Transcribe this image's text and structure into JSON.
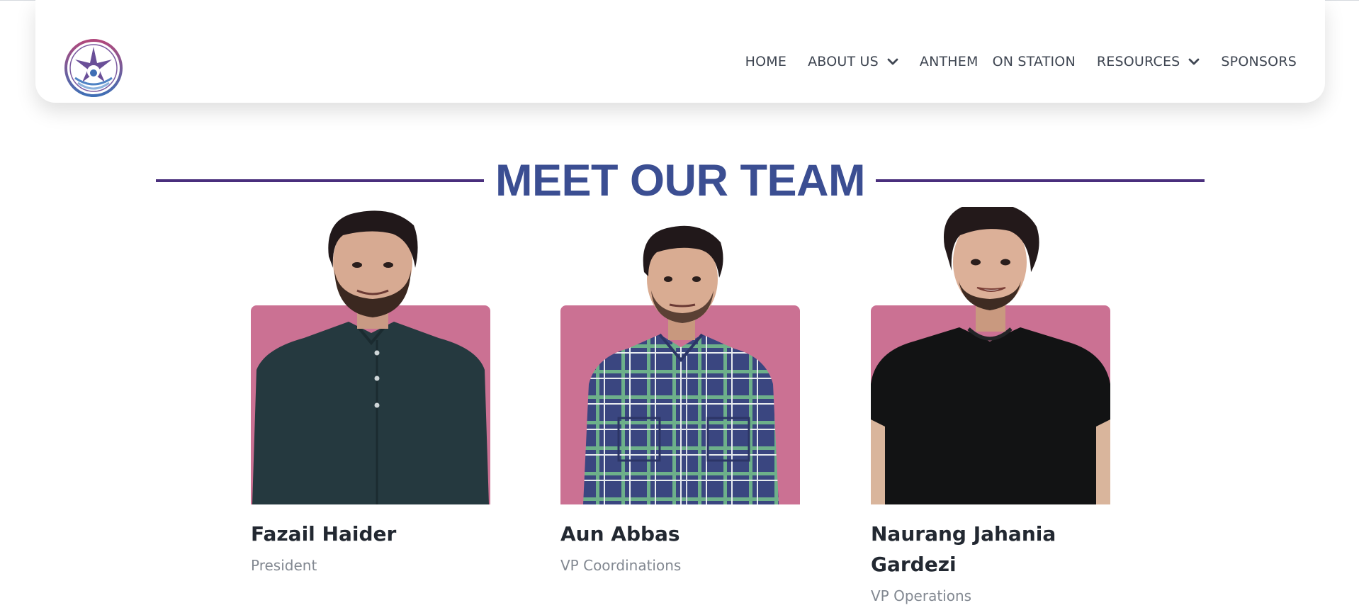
{
  "nav": {
    "items": [
      {
        "label": "HOME"
      },
      {
        "label": "ABOUT US",
        "has_dropdown": true
      },
      {
        "label": "ANTHEM"
      },
      {
        "label": "ON STATION"
      },
      {
        "label": "RESOURCES",
        "has_dropdown": true
      },
      {
        "label": "SPONSORS"
      }
    ],
    "logo_icon": "compass-emblem-icon"
  },
  "section": {
    "title": "MEET OUR TEAM"
  },
  "team": [
    {
      "name": "Fazail Haider",
      "role": "President",
      "shirt": "dark-teal-kurta"
    },
    {
      "name": "Aun Abbas",
      "role": "VP Coordinations",
      "shirt": "navy-green-plaid"
    },
    {
      "name": "Naurang Jahania Gardezi",
      "role": "VP Operations",
      "shirt": "black-tshirt"
    }
  ],
  "colors": {
    "title": "#3b4e92",
    "title_rule": "#4a2f7d",
    "photo_background": "#cb7193",
    "nav_text": "#3f4652",
    "name_text": "#222831",
    "role_text": "#828891"
  }
}
